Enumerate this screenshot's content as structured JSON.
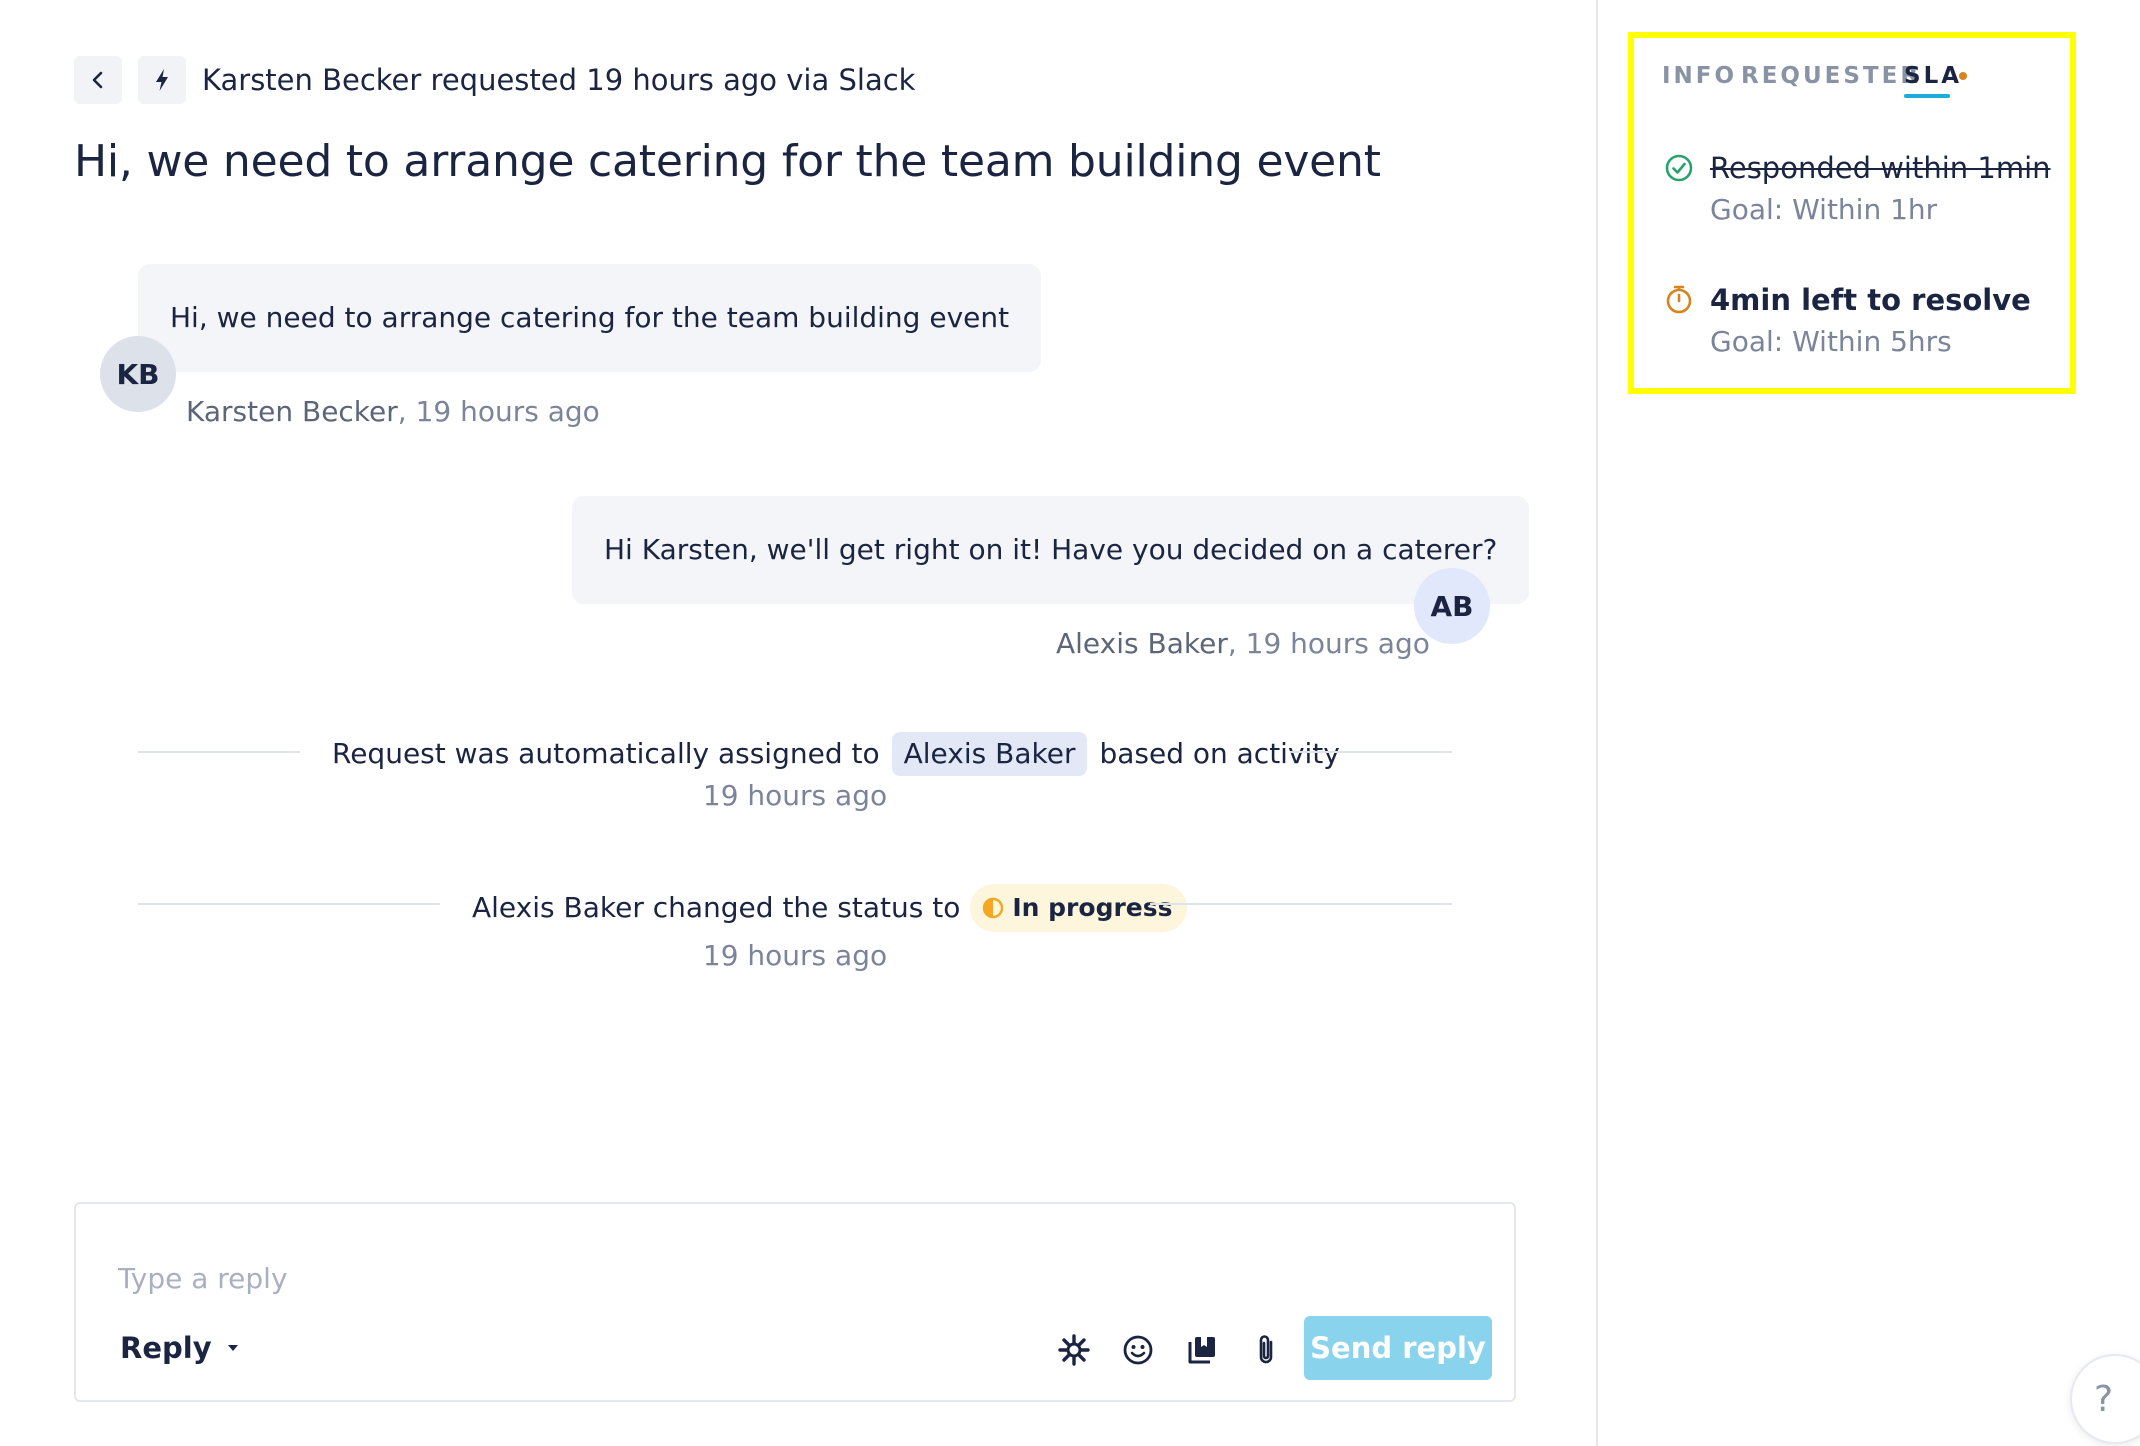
{
  "header": {
    "requester": "Karsten Becker",
    "meta_suffix": "requested 19 hours ago via Slack",
    "title": "Hi, we need to arrange catering for the team building event"
  },
  "messages": [
    {
      "initials": "KB",
      "text": "Hi, we need to arrange catering for the team building event",
      "author": "Karsten Becker",
      "time": ", 19 hours ago",
      "side": "left"
    },
    {
      "initials": "AB",
      "text": "Hi Karsten, we'll get right on it! Have you decided on a caterer?",
      "author": "Alexis Baker",
      "time": ", 19 hours ago",
      "side": "right"
    }
  ],
  "events": [
    {
      "prefix": "Request was automatically assigned to",
      "chip": "Alexis Baker",
      "suffix": "based on activity",
      "time": "19 hours ago"
    },
    {
      "prefix": "Alexis Baker changed the status to",
      "chip": "In progress",
      "time": "19 hours ago"
    }
  ],
  "composer": {
    "placeholder": "Type a reply",
    "value": "",
    "mode_label": "Reply",
    "send_label": "Send reply"
  },
  "help": {
    "label": "?"
  },
  "sidebar": {
    "tabs": [
      {
        "label": "INFO",
        "active": false
      },
      {
        "label": "REQUESTER",
        "active": false
      },
      {
        "label": "SLA",
        "active": true,
        "has_indicator": true
      }
    ],
    "sla": [
      {
        "title": "Responded within 1min",
        "goal": "Goal: Within 1hr",
        "status": "met",
        "icon": "check-circle-icon"
      },
      {
        "title": "4min left to resolve",
        "goal": "Goal: Within 5hrs",
        "status": "pending",
        "icon": "stopwatch-icon"
      }
    ]
  },
  "colors": {
    "accent": "#1aaed6",
    "send_button": "#89d3ec",
    "success": "#27a36b",
    "warning": "#d8831c",
    "status_in_progress": "#f5a623",
    "highlight_border": "#ffff00"
  }
}
